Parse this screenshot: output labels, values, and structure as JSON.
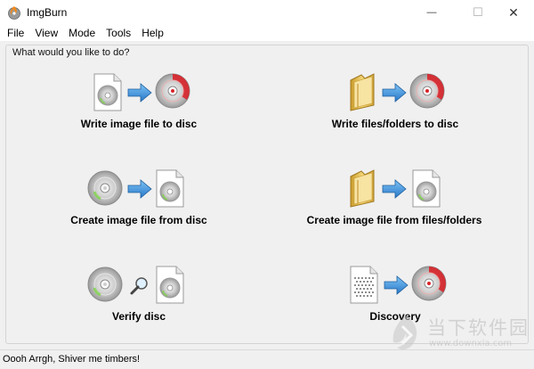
{
  "window": {
    "title": "ImgBurn",
    "minimize_glyph": "—",
    "maximize_glyph": "☐",
    "close_glyph": "✕"
  },
  "menu": {
    "items": [
      "File",
      "View",
      "Mode",
      "Tools",
      "Help"
    ]
  },
  "main": {
    "group_label": "What would you like to do?",
    "tiles": [
      {
        "label": "Write image file to disc",
        "icon": "write-image-icon"
      },
      {
        "label": "Write files/folders to disc",
        "icon": "write-files-icon"
      },
      {
        "label": "Create image file from disc",
        "icon": "create-image-from-disc-icon"
      },
      {
        "label": "Create image file from files/folders",
        "icon": "create-image-from-files-icon"
      },
      {
        "label": "Verify disc",
        "icon": "verify-disc-icon"
      },
      {
        "label": "Discovery",
        "icon": "discovery-icon"
      }
    ]
  },
  "status": {
    "text": "Oooh Arrgh, Shiver me timbers!"
  },
  "watermark": {
    "text_cn": "当下软件园",
    "url": "www.downxia.com"
  },
  "colors": {
    "arrow": "#3a8fdc",
    "disc_red": "#d8242a",
    "folder": "#e8c44a"
  }
}
